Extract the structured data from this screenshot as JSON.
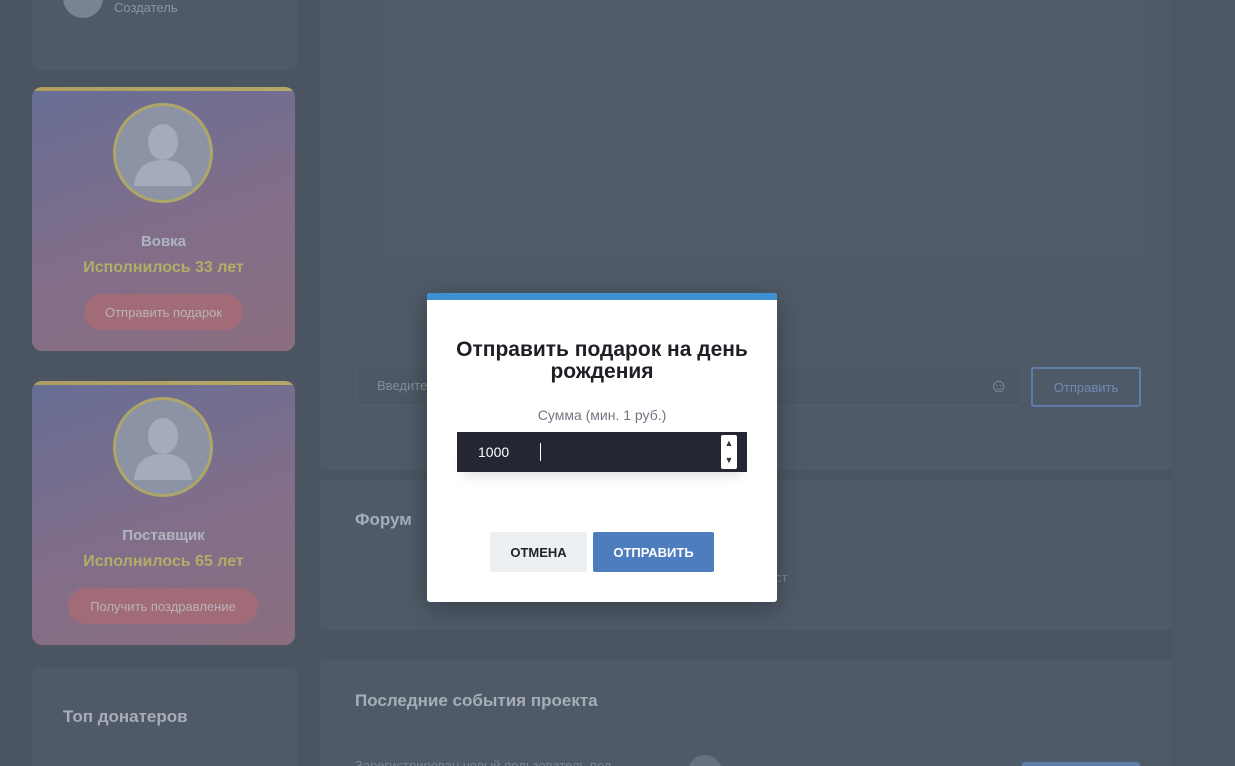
{
  "sidebar": {
    "creator_role": "Создатель",
    "birthdays": [
      {
        "name": "Вовка",
        "age_text": "Исполнилось 33 лет",
        "action_label": "Отправить подарок"
      },
      {
        "name": "Поставщик",
        "age_text": "Исполнилось 65 лет",
        "action_label": "Получить поздравление"
      }
    ],
    "top_donors_title": "Топ донатеров"
  },
  "chat": {
    "input_placeholder": "Введите",
    "send_label": "Отправить"
  },
  "forum": {
    "title": "Форум",
    "fragment": "ст"
  },
  "events": {
    "title": "Последние события проекта",
    "fragment": "Зарегистрирован новый пользователь под"
  },
  "modal": {
    "title": "Отправить подарок на день рождения",
    "amount_label": "Сумма (мин. 1 руб.)",
    "amount_value": "1000",
    "cancel_label": "ОТМЕНА",
    "submit_label": "ОТПРАВИТЬ"
  },
  "colors": {
    "modal_accent": "#3d91d3",
    "submit_button": "#4e7dbd",
    "birthday_age": "#d9cd4a"
  }
}
